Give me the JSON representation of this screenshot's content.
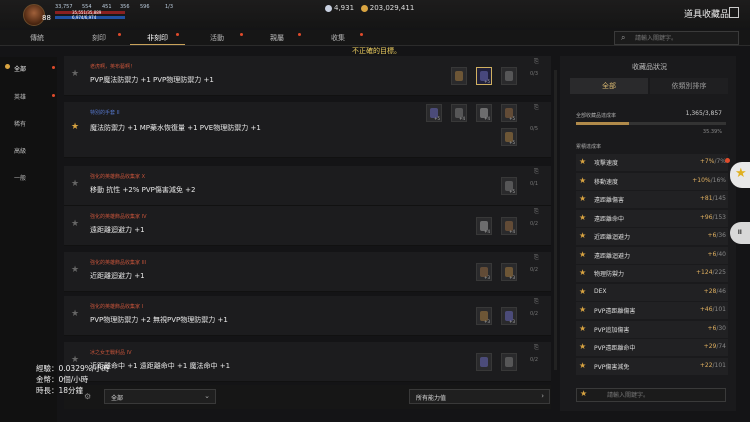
{
  "player": {
    "level": "88",
    "res1": "33,757",
    "res2": "554",
    "res3": "451",
    "res4": "356",
    "res5": "596",
    "res6": "1/3",
    "hp": "35,551/35,889",
    "mp": "6,974/6,974"
  },
  "currency": {
    "item1": "4,931",
    "gold": "203,029,411"
  },
  "header": {
    "title": "道具收藏品"
  },
  "tabs": [
    {
      "label": "傳統"
    },
    {
      "label": "刻印"
    },
    {
      "label": "非刻印"
    },
    {
      "label": "活動"
    },
    {
      "label": "親屬"
    },
    {
      "label": "收集"
    }
  ],
  "notice": "不正確的目標。",
  "search": {
    "placeholder": "請輸入關鍵字。"
  },
  "nav": [
    {
      "label": "全部"
    },
    {
      "label": "英雄"
    },
    {
      "label": "稀有"
    },
    {
      "label": "高級"
    },
    {
      "label": "一般"
    }
  ],
  "rows": [
    {
      "sub": "老虎啊，英布藝啊！",
      "desc": "PVP魔法防禦力 +1 PVP物理防禦力 +1",
      "count": "0/3",
      "slots": [
        "",
        "+5",
        ""
      ]
    },
    {
      "sub": "特別的手套 II",
      "desc": "魔法防禦力 +1 MP藥水恢復量 +1 PVE物理防禦力 +1",
      "count": "0/5",
      "slots": [
        "+5",
        "+4",
        "+4",
        "+5",
        "+5"
      ]
    },
    {
      "sub": "強化的英雄飾品收集家 X",
      "desc": "移動 抗性 +2% PVP傷害減免 +2",
      "count": "0/1",
      "slots": [
        "+5"
      ]
    },
    {
      "sub": "強化的英雄飾品收集家 IV",
      "desc": "遠距離迴避力 +1",
      "count": "0/2",
      "slots": [
        "+4",
        "+4"
      ]
    },
    {
      "sub": "強化的英雄飾品收集家 III",
      "desc": "近距離迴避力 +1",
      "count": "0/2",
      "slots": [
        "+3",
        "+3"
      ]
    },
    {
      "sub": "強化的英雄飾品收集家 I",
      "desc": "PVP物理防禦力 +2 無視PVP物理防禦力 +1",
      "count": "0/2",
      "slots": [
        "+3",
        "+3"
      ]
    },
    {
      "sub": "冰之女王戰利品 IV",
      "desc": "近距離命中 +1 遠距離命中 +1 魔法命中 +1",
      "count": "0/2",
      "slots": [
        "",
        ""
      ]
    }
  ],
  "bottom": {
    "filter1": "全部",
    "filter2": "所有能力值"
  },
  "stats": {
    "exp": "經驗：0.0329%/小時",
    "gold": "金幣：0個/小時",
    "time": "時長：18分鐘"
  },
  "panel": {
    "title": "收藏品狀況",
    "tab1": "全部",
    "tab2": "依類別排序",
    "progress_label": "全部收藏品達成率",
    "progress_val": "1,365/3,857",
    "progress_pct": "35.39%",
    "progress_fraction": 0.3539,
    "section": "累積達成率",
    "stats": [
      {
        "name": "攻擊速度",
        "value": "+7%",
        "max": "/7%"
      },
      {
        "name": "移動速度",
        "value": "+10%",
        "max": "/16%"
      },
      {
        "name": "遠距離傷害",
        "value": "+81",
        "max": "/145"
      },
      {
        "name": "遠距離命中",
        "value": "+96",
        "max": "/153"
      },
      {
        "name": "近距離迴避力",
        "value": "+6",
        "max": "/36"
      },
      {
        "name": "遠距離迴避力",
        "value": "+6",
        "max": "/40"
      },
      {
        "name": "物理防禦力",
        "value": "+124",
        "max": "/225"
      },
      {
        "name": "DEX",
        "value": "+28",
        "max": "/46"
      },
      {
        "name": "PVP遠距離傷害",
        "value": "+46",
        "max": "/101"
      },
      {
        "name": "PVP追加傷害",
        "value": "+6",
        "max": "/30"
      },
      {
        "name": "PVP遠距離命中",
        "value": "+29",
        "max": "/74"
      },
      {
        "name": "PVP傷害減免",
        "value": "+22",
        "max": "/101"
      }
    ],
    "search_placeholder": "請輸入關鍵字。"
  },
  "colors": {
    "accent": "#d9a441",
    "notice": "#f0d060",
    "sub_red": "#c7543a"
  }
}
